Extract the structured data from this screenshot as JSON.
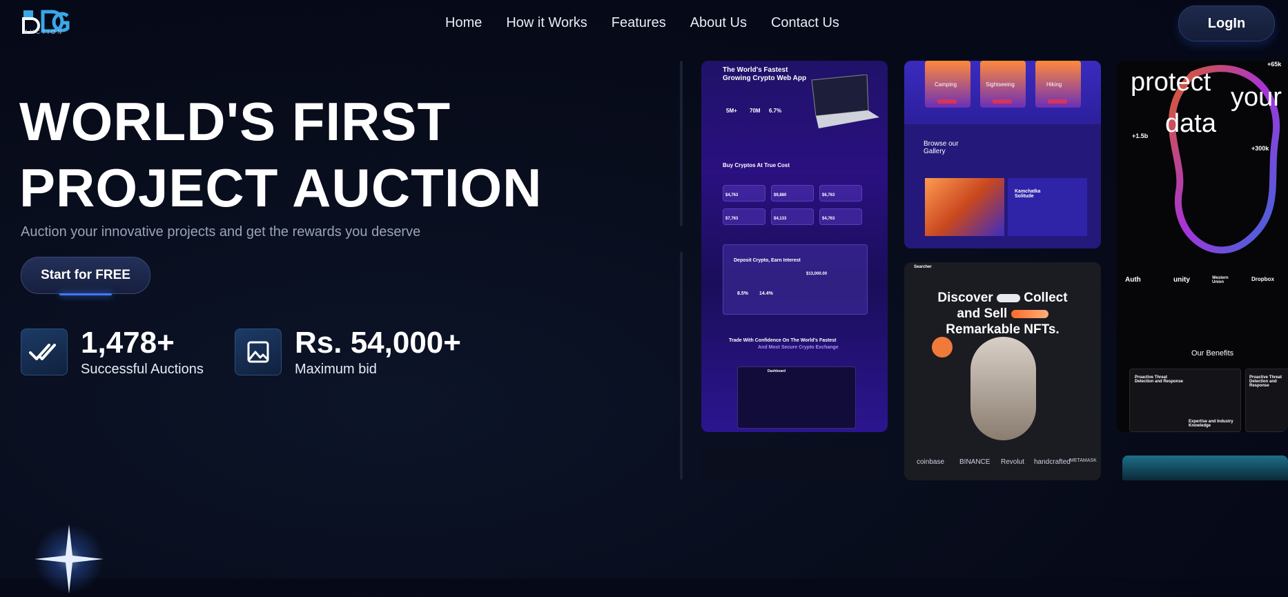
{
  "brand": {
    "logo_mark": "DG",
    "logo_caption": "AUCTION"
  },
  "nav": {
    "items": [
      "Home",
      "How it Works",
      "Features",
      "About Us",
      "Contact Us"
    ],
    "login_label": "LogIn"
  },
  "hero": {
    "title_line1": "WORLD'S FIRST",
    "title_line2": "PROJECT AUCTION",
    "subtitle": "Auction your innovative projects and get the rewards you deserve",
    "cta_label": "Start for FREE"
  },
  "stats": [
    {
      "icon": "double-check-icon",
      "value": "1,478+",
      "label": "Successful Auctions"
    },
    {
      "icon": "image-chart-icon",
      "value": "Rs. 54,000+",
      "label": "Maximum bid"
    }
  ],
  "showcase": {
    "crypto": {
      "headline1": "The World's Fastest",
      "headline2": "Growing Crypto Web App",
      "stats": [
        "5M+",
        "70M",
        "6.7%"
      ],
      "buy_title": "Buy Cryptos At True Cost",
      "prices": [
        "$4,763",
        "$9,880",
        "$6,763",
        "$7,763",
        "$4,133",
        "$4,763"
      ],
      "deposit_title": "Deposit Crypto, Earn Interest",
      "deposit_value": "$13,000.00",
      "rates": [
        "8.5%",
        "14.4%"
      ],
      "trade_title": "Trade With Confidence On The World's Fastest",
      "trade_sub": "And Most Secure Crypto Exchange",
      "dashboard": "Dashboard"
    },
    "travel": {
      "categories": [
        "Camping",
        "Sightseeing",
        "Hiking"
      ],
      "gallery_title": "Browse our Gallery",
      "gallery_item": "Kamchatka Solitude"
    },
    "nft": {
      "brand": "Searcher",
      "line1": "Discover",
      "line1b": "Collect",
      "line2": "and Sell",
      "line3": "Remarkable NFTs.",
      "partners": [
        "coinbase",
        "BINANCE",
        "Revolut",
        "handcrafted",
        "METAMASK"
      ]
    },
    "security": {
      "headline1": "protect",
      "headline1b": "your",
      "headline2": "data",
      "stat_a": "+65k",
      "stat_b": "+1.5b",
      "stat_c": "+300k",
      "partners": [
        "Auth",
        "unity",
        "Western Union",
        "Dropbox"
      ],
      "benefits_title": "Our Benefits",
      "benefit_a": "Proactive Threat Detection and Response",
      "benefit_b": "Expertise and Industry Knowledge",
      "benefit_c": "Proactive Threat Detection and Response"
    }
  },
  "colors": {
    "background": "#070b19",
    "accent": "#3f7bff",
    "crypto_purple": "#2a1080"
  }
}
